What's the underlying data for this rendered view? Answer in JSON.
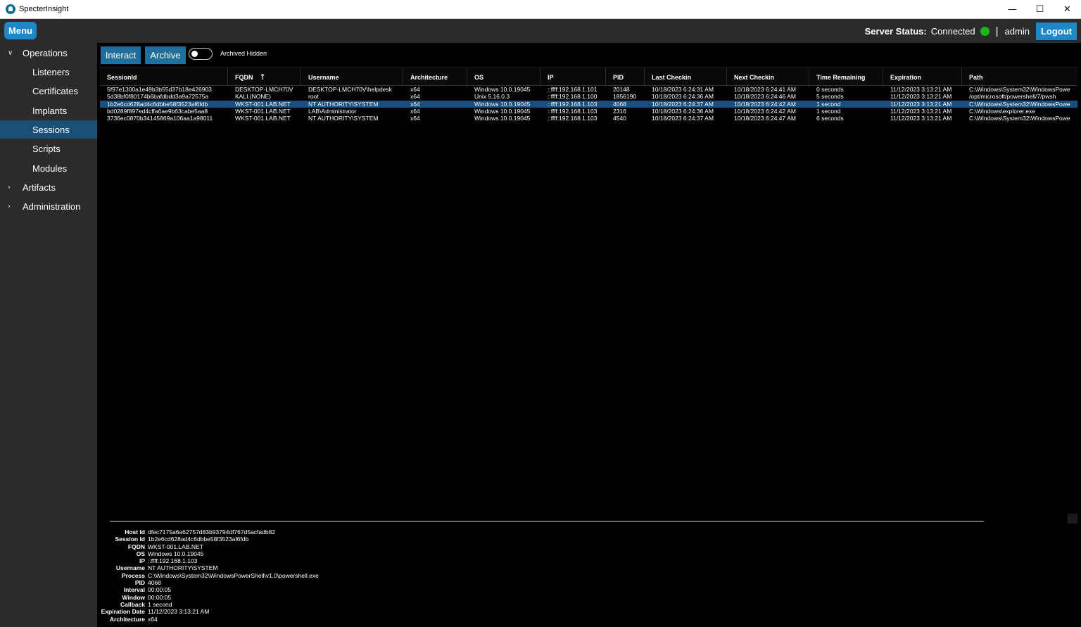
{
  "window": {
    "title": "SpecterInsight",
    "minimize": "—",
    "maximize": "☐",
    "close": "✕"
  },
  "topbar": {
    "menu_label": "Menu",
    "server_status_label": "Server Status:",
    "server_status_value": "Connected",
    "status_color": "#1bb61b",
    "separator": "|",
    "user": "admin",
    "logout_label": "Logout"
  },
  "sidebar": {
    "groups": [
      {
        "label": "Operations",
        "expanded": true,
        "chevron": "∨"
      },
      {
        "label": "Artifacts",
        "expanded": false,
        "chevron": "›"
      },
      {
        "label": "Administration",
        "expanded": false,
        "chevron": "›"
      }
    ],
    "items": [
      {
        "label": "Listeners",
        "active": false
      },
      {
        "label": "Certificates",
        "active": false
      },
      {
        "label": "Implants",
        "active": false
      },
      {
        "label": "Sessions",
        "active": true
      },
      {
        "label": "Scripts",
        "active": false
      },
      {
        "label": "Modules",
        "active": false
      }
    ]
  },
  "toolbar": {
    "interact_label": "Interact",
    "archive_label": "Archive",
    "toggle_label": "Archived Hidden",
    "toggle_on": false
  },
  "grid": {
    "sort_icon": "↑",
    "columns": [
      "SessionId",
      "FQDN",
      "Username",
      "Architecture",
      "OS",
      "IP",
      "PID",
      "Last Checkin",
      "Next Checkin",
      "Time Remaining",
      "Expiration",
      "Path"
    ],
    "rows": [
      {
        "selected": false,
        "cells": [
          "5f97e1300a1e49b3b55d37b18e426903",
          "DESKTOP-LMCH70V",
          "DESKTOP-LMCH70V\\helpdesk",
          "x64",
          "Windows 10.0.19045",
          "::ffff:192.168.1.101",
          "20148",
          "10/18/2023 6:24:31 AM",
          "10/18/2023 6:24:41 AM",
          "0 seconds",
          "11/12/2023 3:13:21 AM",
          "C:\\Windows\\System32\\WindowsPowe"
        ]
      },
      {
        "selected": false,
        "cells": [
          "5d38bf0f80174b6bafdbdd3a9a72575a",
          "KALI.(NONE)",
          "root",
          "x64",
          "Unix 5.16.0.3",
          "::ffff:192.168.1.100",
          "1856190",
          "10/18/2023 6:24:36 AM",
          "10/18/2023 6:24:46 AM",
          "5 seconds",
          "11/12/2023 3:13:21 AM",
          "/opt/microsoft/powershell/7/pwsh"
        ]
      },
      {
        "selected": true,
        "cells": [
          "1b2e6cd628ad4c6dbbe58f3523af6fdb",
          "WKST-001.LAB.NET",
          "NT AUTHORITY\\SYSTEM",
          "x64",
          "Windows 10.0.19045",
          "::ffff:192.168.1.103",
          "4068",
          "10/18/2023 6:24:37 AM",
          "10/18/2023 6:24:42 AM",
          "1 second",
          "11/12/2023 3:13:21 AM",
          "C:\\Windows\\System32\\WindowsPowe"
        ]
      },
      {
        "selected": false,
        "cells": [
          "bd0289f897ed4cffa6ae9b63cabe5aa8",
          "WKST-001.LAB.NET",
          "LAB\\Administrator",
          "x64",
          "Windows 10.0.19045",
          "::ffff:192.168.1.103",
          "2316",
          "10/18/2023 6:24:36 AM",
          "10/18/2023 6:24:42 AM",
          "1 second",
          "11/12/2023 3:13:21 AM",
          "C:\\Windows\\explorer.exe"
        ]
      },
      {
        "selected": false,
        "cells": [
          "3736ec0870b34145869a106aa1a98011",
          "WKST-001.LAB.NET",
          "NT AUTHORITY\\SYSTEM",
          "x64",
          "Windows 10.0.19045",
          "::ffff:192.168.1.103",
          "4540",
          "10/18/2023 6:24:37 AM",
          "10/18/2023 6:24:47 AM",
          "6 seconds",
          "11/12/2023 3:13:21 AM",
          "C:\\Windows\\System32\\WindowsPowe"
        ]
      }
    ]
  },
  "details": [
    {
      "label": "Host Id",
      "value": "dfec7175a6a62757d83b93794df767d5acfadb82"
    },
    {
      "label": "Session Id",
      "value": "1b2e6cd628ad4c6dbbe58f3523af6fdb"
    },
    {
      "label": "FQDN",
      "value": "WKST-001.LAB.NET"
    },
    {
      "label": "OS",
      "value": "Windows 10.0.19045"
    },
    {
      "label": "IP",
      "value": "::ffff:192.168.1.103"
    },
    {
      "label": "Username",
      "value": "NT AUTHORITY\\SYSTEM"
    },
    {
      "label": "Process",
      "value": "C:\\Windows\\System32\\WindowsPowerShell\\v1.0\\powershell.exe"
    },
    {
      "label": "PID",
      "value": "4068"
    },
    {
      "label": "Interval",
      "value": "00:00:05"
    },
    {
      "label": "Window",
      "value": "00:00:05"
    },
    {
      "label": "Callback",
      "value": "1 second"
    },
    {
      "label": "Expiration Date",
      "value": "11/12/2023 3:13:21 AM"
    },
    {
      "label": "Architecture",
      "value": "x64"
    }
  ]
}
